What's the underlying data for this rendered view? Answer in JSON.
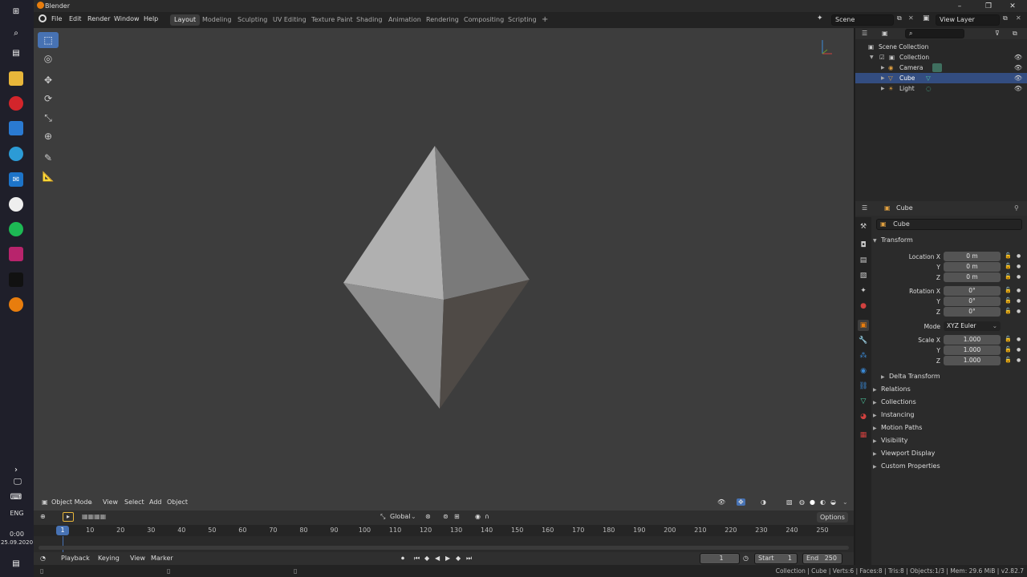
{
  "window": {
    "title": "Blender",
    "controls": [
      "–",
      "❐",
      "✕"
    ]
  },
  "taskbar": {
    "language": "ENG",
    "time": "0:00",
    "date": "25.09.2020"
  },
  "menu": [
    "File",
    "Edit",
    "Render",
    "Window",
    "Help"
  ],
  "workspaces": [
    "Layout",
    "Modeling",
    "Sculpting",
    "UV Editing",
    "Texture Paint",
    "Shading",
    "Animation",
    "Rendering",
    "Compositing",
    "Scripting"
  ],
  "add_workspace": "+",
  "scene": "Scene",
  "view_layer": "View Layer",
  "viewport": {
    "mode": "Object Mode",
    "menus": [
      "View",
      "Select",
      "Add",
      "Object"
    ],
    "transform_orientation": "Global",
    "options": "Options"
  },
  "timeline": {
    "menus": [
      "Playback",
      "Keying",
      "View",
      "Marker"
    ],
    "ticks": [
      "1",
      "10",
      "20",
      "30",
      "40",
      "50",
      "60",
      "70",
      "80",
      "90",
      "100",
      "110",
      "120",
      "130",
      "140",
      "150",
      "160",
      "170",
      "180",
      "190",
      "200",
      "210",
      "220",
      "230",
      "240",
      "250"
    ],
    "current_frame": "1",
    "start_label": "Start",
    "start": "1",
    "end_label": "End",
    "end": "250"
  },
  "outliner": {
    "root": "Scene Collection",
    "collection": "Collection",
    "items": [
      "Camera",
      "Cube",
      "Light"
    ],
    "selected": "Cube"
  },
  "properties": {
    "object_name": "Cube",
    "datablock_name": "Cube",
    "transform_title": "Transform",
    "location": {
      "label_x": "Location X",
      "label_y": "Y",
      "label_z": "Z",
      "x": "0 m",
      "y": "0 m",
      "z": "0 m"
    },
    "rotation": {
      "label_x": "Rotation X",
      "label_y": "Y",
      "label_z": "Z",
      "x": "0°",
      "y": "0°",
      "z": "0°"
    },
    "mode_label": "Mode",
    "mode": "XYZ Euler",
    "scale": {
      "label_x": "Scale X",
      "label_y": "Y",
      "label_z": "Z",
      "x": "1.000",
      "y": "1.000",
      "z": "1.000"
    },
    "delta_transform": "Delta Transform",
    "panels": [
      "Relations",
      "Collections",
      "Instancing",
      "Motion Paths",
      "Visibility",
      "Viewport Display",
      "Custom Properties"
    ]
  },
  "statusbar": "Collection | Cube | Verts:6 | Faces:8 | Tris:8 | Objects:1/3 | Mem: 29.6 MiB | v2.82.7",
  "colors": {
    "accent": "#4772b3",
    "selected_row": "#334d80",
    "viewport_bg": "#3d3d3d"
  }
}
